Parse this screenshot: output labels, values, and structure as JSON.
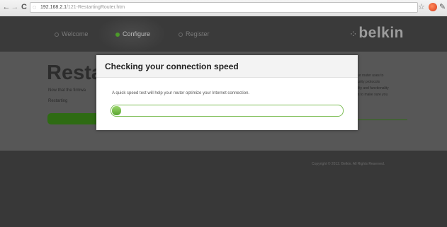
{
  "browser": {
    "back_glyph": "←",
    "forward_glyph": "→",
    "reload_glyph": "C",
    "url_host": "192.168.2.1",
    "url_path": "/121-RestartingRouter.htm",
    "icons": [
      "back-arrow-icon",
      "forward-arrow-icon",
      "reload-icon",
      "page-icon",
      "star-icon",
      "extension-icon",
      "wrench-icon"
    ]
  },
  "header": {
    "steps": [
      {
        "label": "Welcome",
        "state": "inactive"
      },
      {
        "label": "Configure",
        "state": "active"
      },
      {
        "label": "Register",
        "state": "inactive"
      }
    ],
    "logo": "belkin"
  },
  "background": {
    "heading": "Restar",
    "subtext": "Now that the firmwa",
    "status": "Restarting",
    "side_text": "ur router uses to\nurity protocols\nlity and functionality\ns to make sure you",
    "copyright": "Copyright © 2012. Belkin. All Rights Reserved."
  },
  "dialog": {
    "title": "Checking your connection speed",
    "message": "A quick speed test will help your router optimize your Internet connection.",
    "progress": 0.04
  },
  "colors": {
    "accent_green": "#5aa530",
    "progress_border": "#7cbd54",
    "overlay": "#4d4d4d"
  }
}
